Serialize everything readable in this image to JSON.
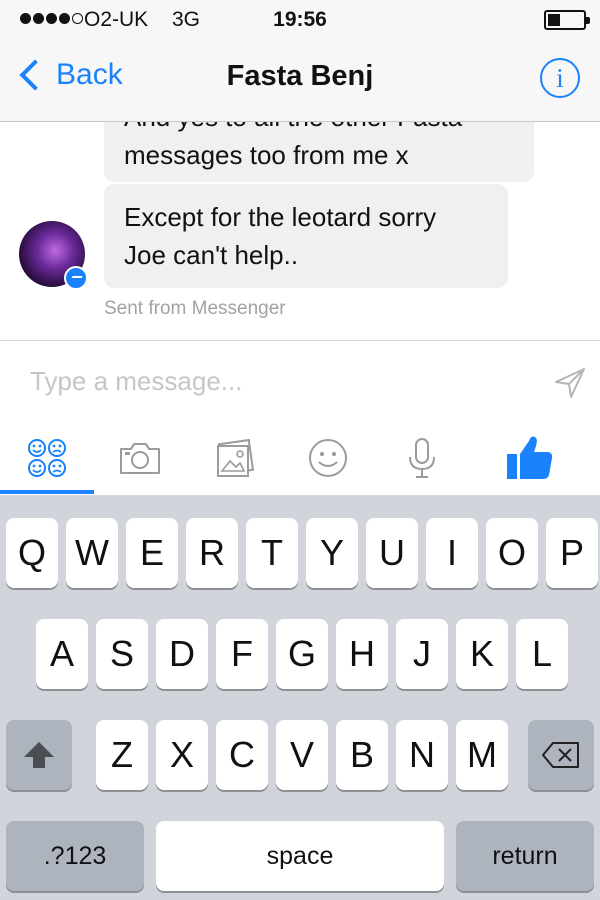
{
  "status_bar": {
    "carrier": "O2-UK",
    "network": "3G",
    "time": "19:56",
    "signal_bars": 4,
    "signal_bars_max": 5,
    "battery_level": 0.35
  },
  "nav": {
    "back_label": "Back",
    "title": "Fasta Benj",
    "info_label": "i"
  },
  "conversation": {
    "messages": [
      {
        "text_line1": "And yes to all the other Fasta",
        "text_line2": "messages too from me x"
      },
      {
        "text_line1": "Except for the leotard sorry",
        "text_line2": "Joe can't help.."
      }
    ],
    "sent_from": "Sent from Messenger"
  },
  "composer": {
    "placeholder": "Type a message..."
  },
  "toolbar": {
    "icons": [
      "stickers-icon",
      "camera-icon",
      "photo-gallery-icon",
      "emoji-icon",
      "microphone-icon",
      "like-icon"
    ],
    "active_tab": "stickers"
  },
  "keyboard": {
    "row1": [
      "Q",
      "W",
      "E",
      "R",
      "T",
      "Y",
      "U",
      "I",
      "O",
      "P"
    ],
    "row2": [
      "A",
      "S",
      "D",
      "F",
      "G",
      "H",
      "J",
      "K",
      "L"
    ],
    "row3": [
      "Z",
      "X",
      "C",
      "V",
      "B",
      "N",
      "M"
    ],
    "numbers_label": ".?123",
    "space_label": "space",
    "return_label": "return"
  },
  "colors": {
    "accent": "#1a82fb",
    "bubble": "#f0f0f2",
    "keyboard_bg": "#d1d5db"
  }
}
